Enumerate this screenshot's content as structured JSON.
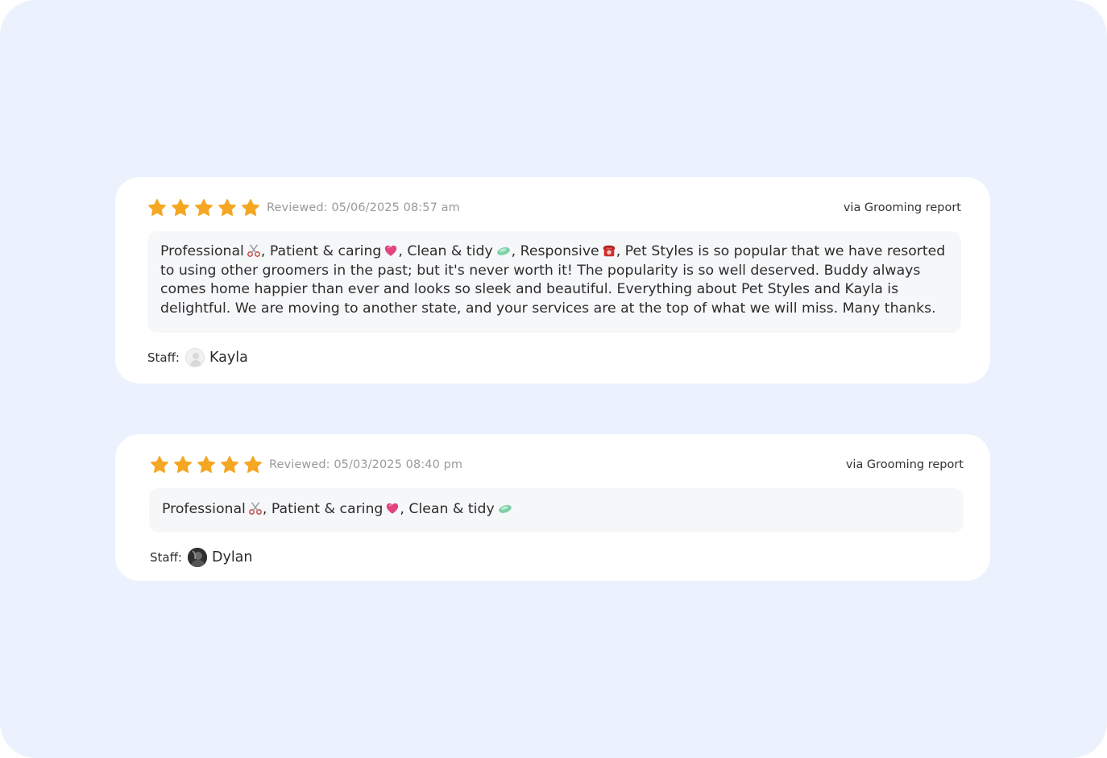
{
  "colors": {
    "background": "#ebf2fd",
    "card": "#ffffff",
    "star": "#f5a623",
    "text_body_bg": "#f6f7f9"
  },
  "reviews": [
    {
      "rating": 5,
      "reviewed": "Reviewed: 05/06/2025 08:57 am",
      "source": "via Grooming report",
      "tags": [
        {
          "label": "Professional",
          "icon": "scissors-icon"
        },
        {
          "label": ", Patient & caring",
          "icon": "heart-icon"
        },
        {
          "label": ", Clean & tidy",
          "icon": "soap-icon"
        },
        {
          "label": ", Responsive",
          "icon": "telephone-icon"
        }
      ],
      "comment": ", Pet Styles is so popular that we have resorted to using other groomers in the past; but it's never worth it! The popularity is so well deserved. Buddy always comes home happier than ever and looks so sleek and beautiful. Everything about Pet Styles and Kayla is delightful. We are moving to another state, and your services are at the top of what we will miss. Many thanks.",
      "staff_label": "Staff:",
      "staff_name": "Kayla"
    },
    {
      "rating": 5,
      "reviewed": "Reviewed: 05/03/2025 08:40 pm",
      "source": "via Grooming report",
      "tags": [
        {
          "label": "Professional",
          "icon": "scissors-icon"
        },
        {
          "label": ", Patient & caring",
          "icon": "heart-icon"
        },
        {
          "label": ", Clean & tidy",
          "icon": "soap-icon"
        }
      ],
      "comment": "",
      "staff_label": "Staff:",
      "staff_name": "Dylan"
    }
  ]
}
